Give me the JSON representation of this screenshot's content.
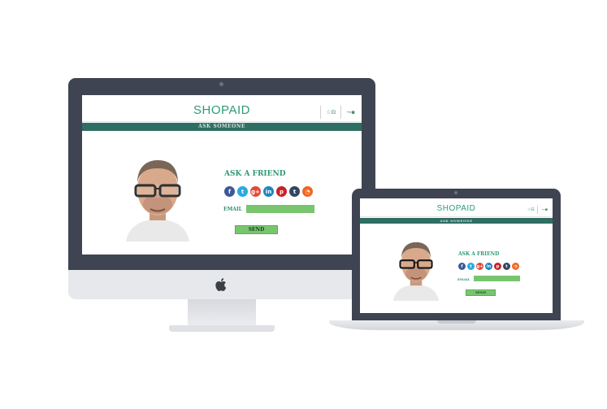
{
  "site": {
    "logo": "SHOPAID",
    "header_icons": {
      "wishlist": "☆",
      "wishlist_box": "⊟",
      "cart": "⇁",
      "cart_box": "▪"
    }
  },
  "band": {
    "label": "ASK SOMEONE"
  },
  "ask": {
    "title": "ASK A FRIEND",
    "email_label": "EMAIL",
    "email_value": "",
    "send_label": "SEND"
  },
  "social": [
    {
      "name": "facebook",
      "glyph": "f",
      "color": "#3b5998"
    },
    {
      "name": "twitter",
      "glyph": "t",
      "color": "#2aa9e0"
    },
    {
      "name": "google-plus",
      "glyph": "g+",
      "color": "#dd4b39"
    },
    {
      "name": "linkedin",
      "glyph": "in",
      "color": "#1c87bd"
    },
    {
      "name": "pinterest",
      "glyph": "p",
      "color": "#cb2027"
    },
    {
      "name": "tumblr",
      "glyph": "t",
      "color": "#35465c"
    },
    {
      "name": "rss",
      "glyph": "◔",
      "color": "#f26522"
    }
  ],
  "colors": {
    "brand_green": "#2c9a7a",
    "band_teal": "#2f6e62",
    "button_green": "#79c56f",
    "device_dark": "#3e4451"
  }
}
